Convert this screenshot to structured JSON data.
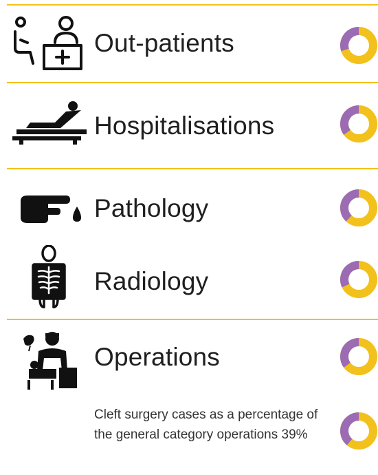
{
  "colors": {
    "accent": "#f2c11b",
    "purple": "#9b6bb4",
    "icon": "#111111"
  },
  "rows": [
    {
      "label": "Out-patients",
      "icon": "patient-at-desk-icon",
      "share": 0.3
    },
    {
      "label": "Hospitalisations",
      "icon": "patient-in-bed-icon",
      "share": 0.35
    },
    {
      "label": "Pathology",
      "icon": "finger-blood-drop-icon",
      "share": 0.38
    },
    {
      "label": "Radiology",
      "icon": "xray-body-icon",
      "share": 0.32
    },
    {
      "label": "Operations",
      "icon": "surgeon-operating-icon",
      "share": 0.35
    }
  ],
  "note": {
    "text": "Cleft surgery cases as a percentage of the general category operations 39%",
    "share": 0.39
  }
}
